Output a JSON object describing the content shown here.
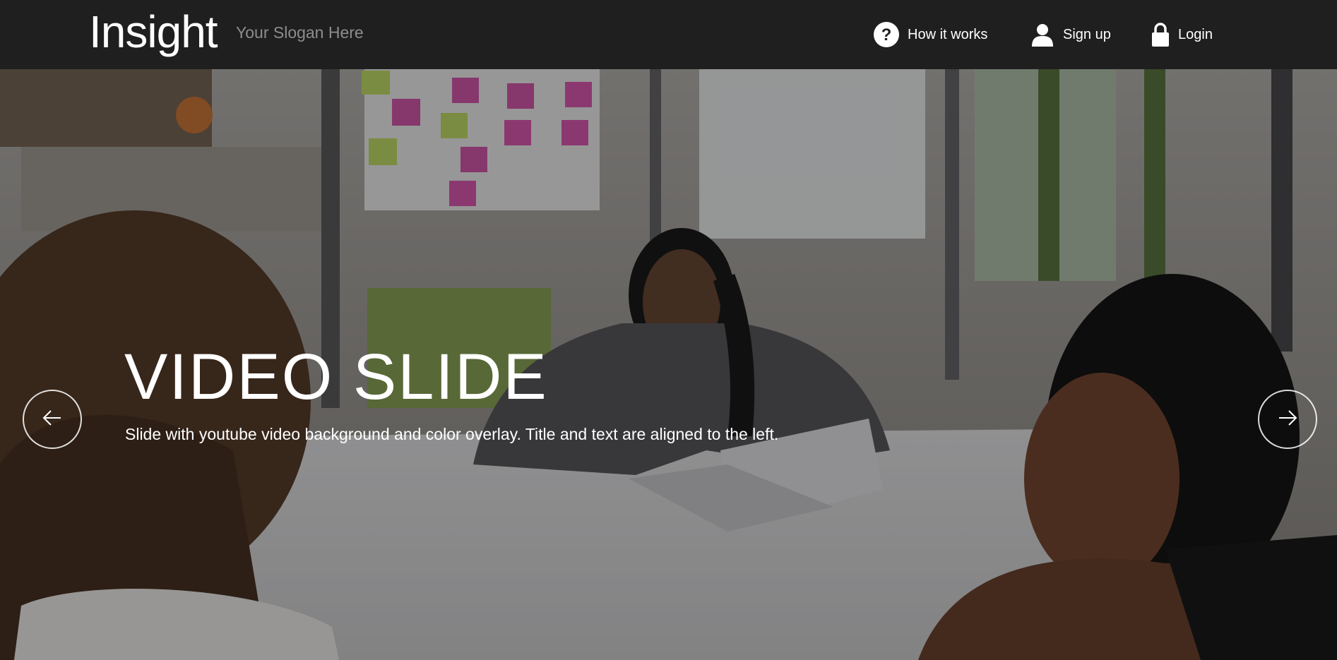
{
  "header": {
    "brand": "Insight",
    "slogan": "Your Slogan Here",
    "nav": [
      {
        "label": "How it works",
        "icon": "question-circle-icon"
      },
      {
        "label": "Sign up",
        "icon": "user-icon"
      },
      {
        "label": "Login",
        "icon": "lock-icon"
      }
    ]
  },
  "slide": {
    "title": "VIDEO SLIDE",
    "text": "Slide with youtube video background and color overlay. Title and text are aligned to the left.",
    "prev_icon": "arrow-left-icon",
    "next_icon": "arrow-right-icon"
  },
  "colors": {
    "navbar": "#1f1f1f",
    "slogan": "#8d8d8d",
    "text": "#ffffff"
  }
}
